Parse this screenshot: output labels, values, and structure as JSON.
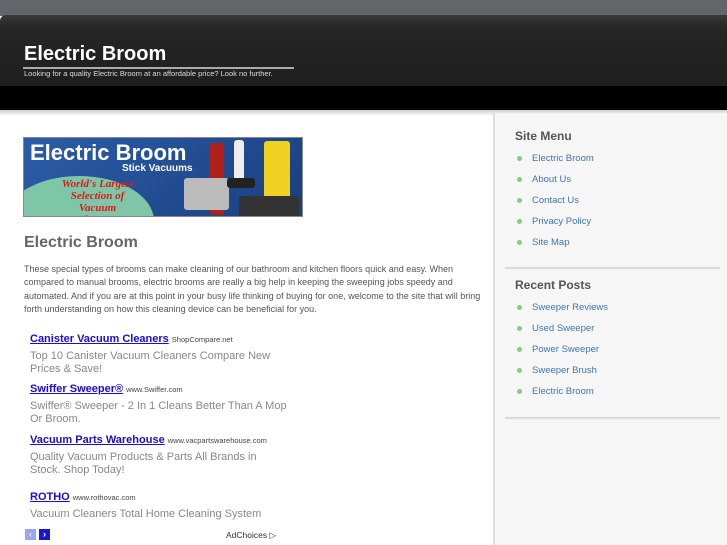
{
  "header": {
    "title": "Electric Broom",
    "tagline": "Looking for a quality Electric Broom at an affordable price? Look no further."
  },
  "banner": {
    "title": "Electric Broom",
    "subtitle": "Stick Vacuums",
    "slogan": "World's Largest Selection of Vacuum Cleaners"
  },
  "main": {
    "heading": "Electric Broom",
    "intro": "These special types of brooms can make cleaning of our bathroom and kitchen floors quick and easy. When compared to manual brooms, electric brooms are really a big help in keeping the sweeping jobs speedy and automated. And if you are at this point in your busy life thinking of buying for one, welcome to the site that will bring forth understanding on how this cleaning device can be beneficial for you."
  },
  "ads": [
    {
      "title": "Canister Vacuum Cleaners",
      "url": "ShopCompare.net",
      "desc": "Top 10 Canister Vacuum Cleaners Compare New Prices & Save!"
    },
    {
      "title": "Swiffer Sweeper®",
      "url": "www.Swiffer.com",
      "desc": "Swiffer® Sweeper - 2 In 1 Cleans Better Than A Mop Or Broom."
    },
    {
      "title": "Vacuum Parts Warehouse",
      "url": "www.vacpartswarehouse.com",
      "desc": "Quality Vacuum Products & Parts All Brands in Stock. Shop Today!"
    },
    {
      "title": "ROTHO",
      "url": "www.rothovac.com",
      "desc": "Vacuum Cleaners Total Home Cleaning System"
    }
  ],
  "ad_nav": {
    "prev": "‹",
    "next": "›",
    "adchoices": "AdChoices ▷"
  },
  "sidebar": {
    "menu_title": "Site Menu",
    "menu": [
      "Electric Broom",
      "About Us",
      "Contact Us",
      "Privacy Policy",
      "Site Map"
    ],
    "posts_title": "Recent Posts",
    "posts": [
      "Sweeper Reviews",
      "Used Sweeper",
      "Power Sweeper",
      "Sweeper Brush",
      "Electric Broom"
    ]
  }
}
